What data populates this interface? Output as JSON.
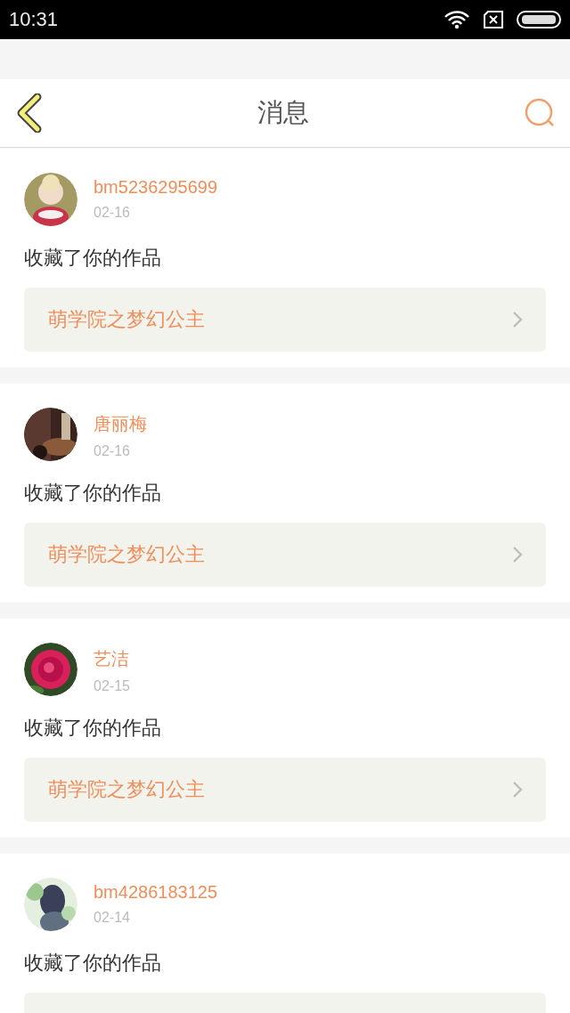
{
  "status_bar": {
    "time": "10:31"
  },
  "header": {
    "title": "消息"
  },
  "messages": [
    {
      "user": "bm5236295699",
      "date": "02-16",
      "action": "收藏了你的作品",
      "work_title": "萌学院之梦幻公主"
    },
    {
      "user": "唐丽梅",
      "date": "02-16",
      "action": "收藏了你的作品",
      "work_title": "萌学院之梦幻公主"
    },
    {
      "user": "艺洁",
      "date": "02-15",
      "action": "收藏了你的作品",
      "work_title": "萌学院之梦幻公主"
    },
    {
      "user": "bm4286183125",
      "date": "02-14",
      "action": "收藏了你的作品"
    }
  ]
}
